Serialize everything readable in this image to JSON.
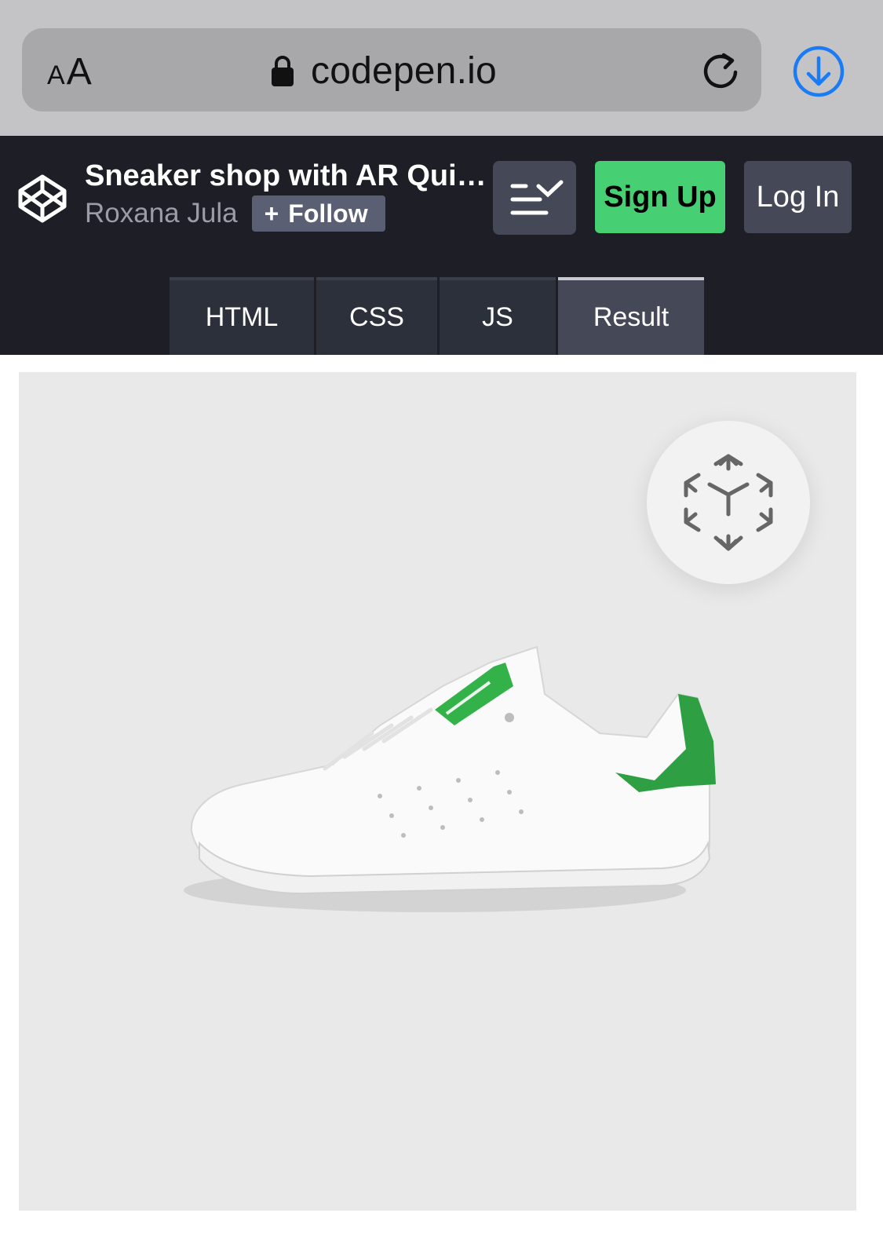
{
  "browser": {
    "text_size_small": "A",
    "text_size_large": "A",
    "url": "codepen.io"
  },
  "pen": {
    "title": "Sneaker shop with AR Qui…",
    "author": "Roxana Jula",
    "follow_label": "Follow",
    "follow_symbol": "+"
  },
  "header": {
    "signup_label": "Sign Up",
    "login_label": "Log In"
  },
  "tabs": [
    {
      "label": "HTML",
      "active": false
    },
    {
      "label": "CSS",
      "active": false
    },
    {
      "label": "JS",
      "active": false
    },
    {
      "label": "Result",
      "active": true
    }
  ],
  "colors": {
    "accent_green": "#47cf73",
    "download_blue": "#1a7cf5",
    "header_bg": "#1e1f26",
    "sneaker_green": "#2ea043"
  },
  "icons": [
    "lock-icon",
    "reload-icon",
    "download-icon",
    "codepen-logo-icon",
    "view-switcher-icon",
    "ar-cube-icon"
  ]
}
